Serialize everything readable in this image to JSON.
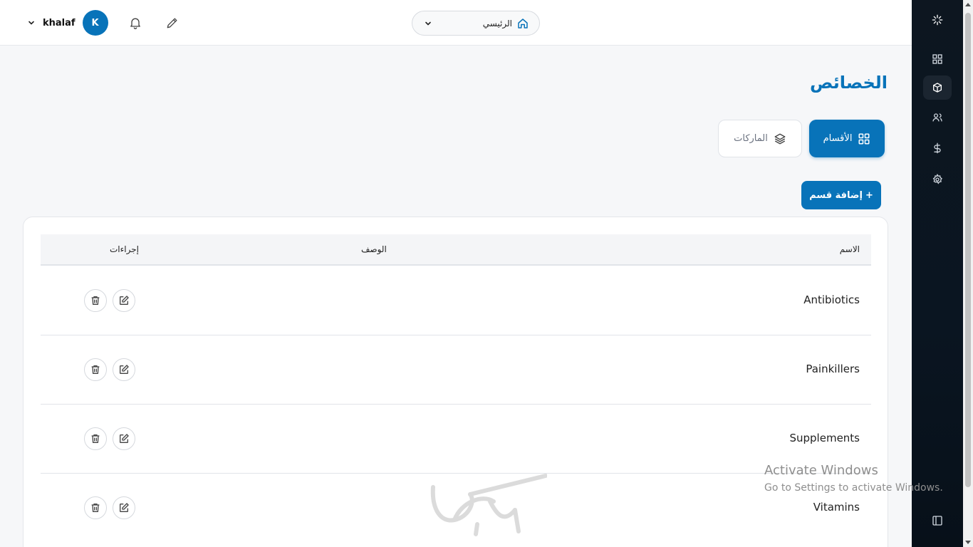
{
  "topbar": {
    "username": "khalaf",
    "avatar_initial": "K",
    "home_label": "الرئيسي"
  },
  "sidebar": {
    "items": [
      {
        "icon": "spinner-icon"
      },
      {
        "icon": "grid-icon"
      },
      {
        "icon": "box-icon",
        "active": true
      },
      {
        "icon": "users-icon"
      },
      {
        "icon": "dollar-icon"
      },
      {
        "icon": "gear-icon"
      },
      {
        "icon": "panel-toggle-icon"
      }
    ]
  },
  "page": {
    "title": "الخصائص",
    "tabs": [
      {
        "label": "الأقسام",
        "active": true
      },
      {
        "label": "الماركات",
        "active": false
      }
    ],
    "add_button": "إضافة قسم",
    "add_button_icon": "+"
  },
  "table": {
    "headers": {
      "name": "الاسم",
      "description": "الوصف",
      "actions": "إجراءات"
    },
    "rows": [
      {
        "name": "Antibiotics",
        "description": ""
      },
      {
        "name": "Painkillers",
        "description": ""
      },
      {
        "name": "Supplements",
        "description": ""
      },
      {
        "name": "Vitamins",
        "description": ""
      }
    ]
  },
  "os_watermark": {
    "line1": "Activate Windows",
    "line2": "Go to Settings to activate Windows."
  },
  "logo_watermark_text": "بيانيكا",
  "colors": {
    "primary": "#0873b9",
    "sidebar_bg": "#0a1521"
  }
}
